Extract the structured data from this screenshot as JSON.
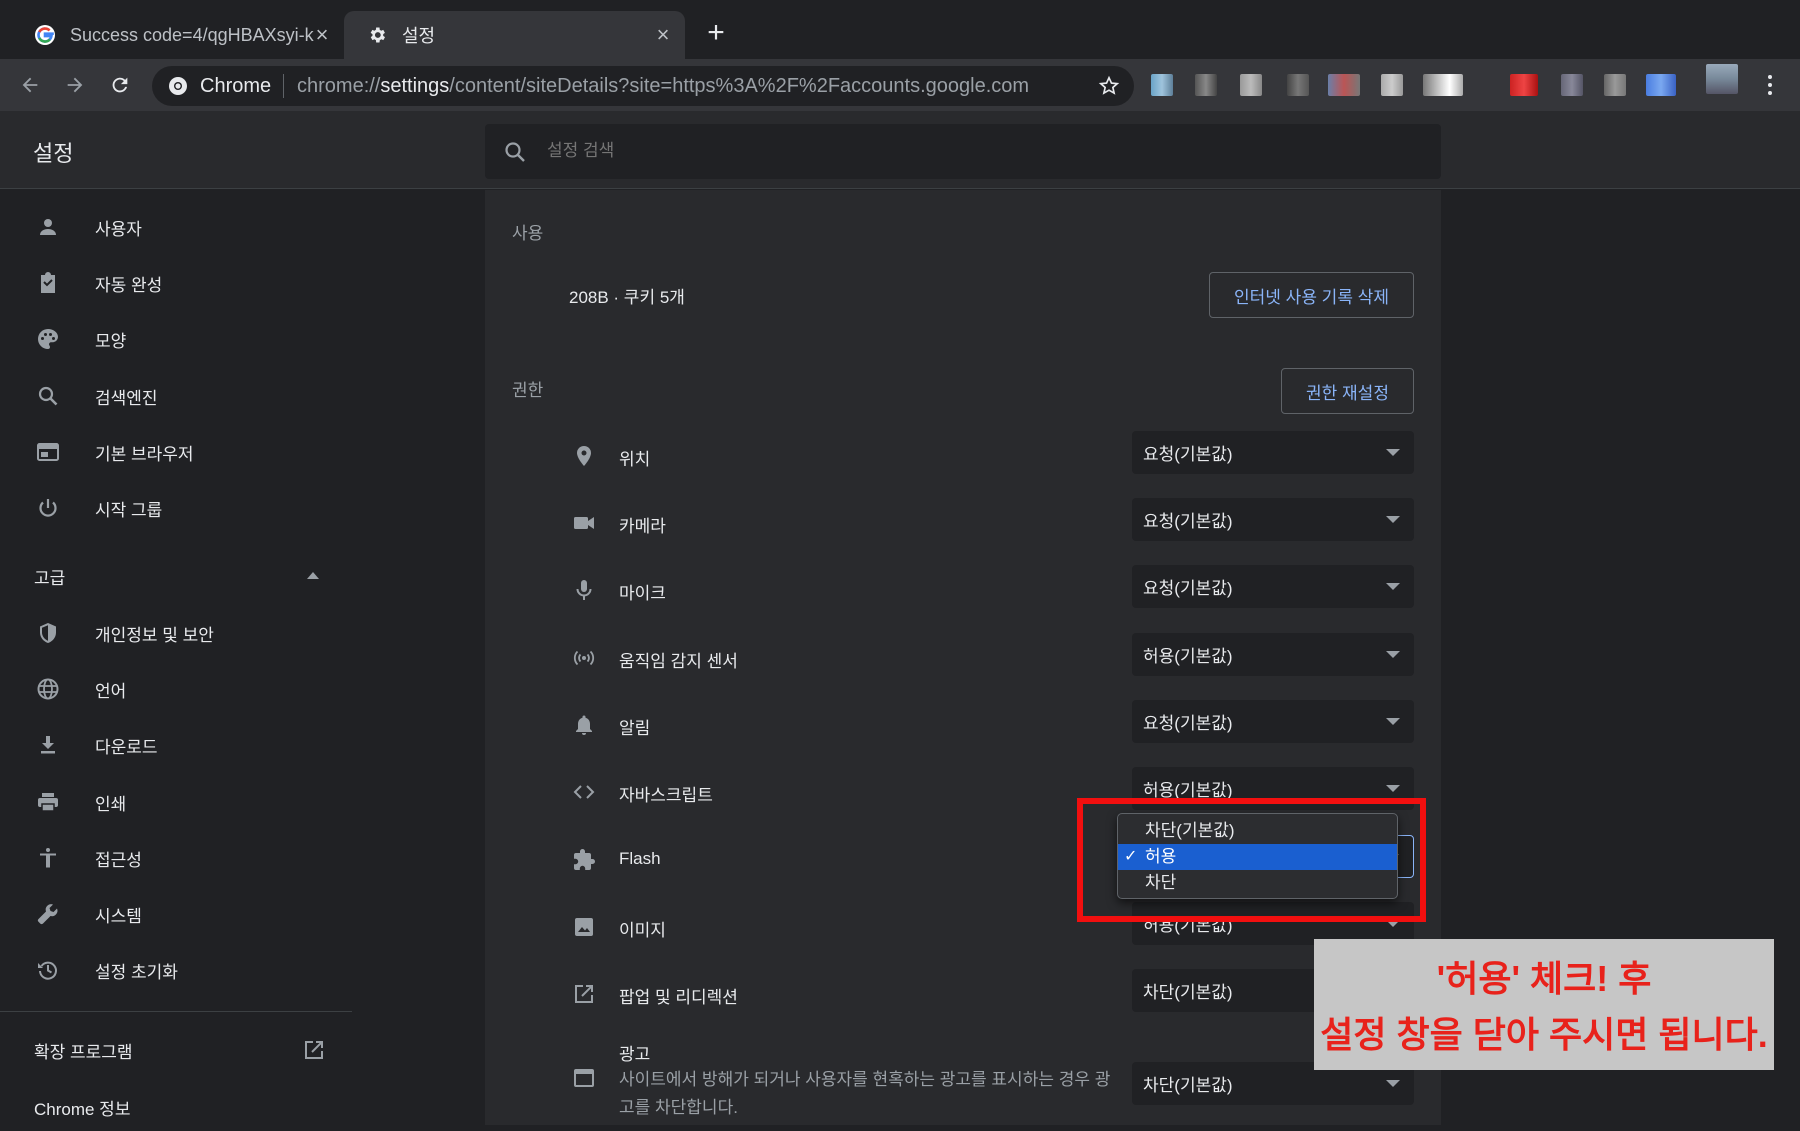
{
  "tabs": [
    {
      "title": "Success code=4/qgHBAXsyi-k",
      "icon": "google-g-icon",
      "active": false
    },
    {
      "title": "설정",
      "icon": "gear-icon",
      "active": true
    }
  ],
  "new_tab_label": "+",
  "omnibox": {
    "site_label": "Chrome",
    "url_prefix": "chrome://",
    "url_host": "settings",
    "url_path": "/content/siteDetails?site=https%3A%2F%2Faccounts.google.com"
  },
  "header": {
    "title": "설정",
    "search_placeholder": "설정 검색"
  },
  "sidebar": {
    "items": [
      {
        "label": "사용자",
        "icon": "person-icon"
      },
      {
        "label": "자동 완성",
        "icon": "clipboard-icon"
      },
      {
        "label": "모양",
        "icon": "palette-icon"
      },
      {
        "label": "검색엔진",
        "icon": "search-icon"
      },
      {
        "label": "기본 브라우저",
        "icon": "browser-icon"
      },
      {
        "label": "시작 그룹",
        "icon": "power-icon"
      }
    ],
    "advanced_label": "고급",
    "advanced_items": [
      {
        "label": "개인정보 및 보안",
        "icon": "shield-icon"
      },
      {
        "label": "언어",
        "icon": "globe-icon"
      },
      {
        "label": "다운로드",
        "icon": "download-icon"
      },
      {
        "label": "인쇄",
        "icon": "printer-icon"
      },
      {
        "label": "접근성",
        "icon": "accessibility-icon"
      },
      {
        "label": "시스템",
        "icon": "wrench-icon"
      },
      {
        "label": "설정 초기화",
        "icon": "history-icon"
      }
    ],
    "extensions_label": "확장 프로그램",
    "about_label": "Chrome 정보"
  },
  "usage": {
    "section_title": "사용",
    "summary": "208B · 쿠키 5개",
    "clear_button": "인터넷 사용 기록 삭제"
  },
  "permissions": {
    "section_title": "권한",
    "reset_button": "권한 재설정",
    "rows": [
      {
        "label": "위치",
        "icon": "location-pin-icon",
        "value": "요청(기본값)"
      },
      {
        "label": "카메라",
        "icon": "camera-icon",
        "value": "요청(기본값)"
      },
      {
        "label": "마이크",
        "icon": "microphone-icon",
        "value": "요청(기본값)"
      },
      {
        "label": "움직임 감지 센서",
        "icon": "sensor-icon",
        "value": "허용(기본값)"
      },
      {
        "label": "알림",
        "icon": "bell-icon",
        "value": "요청(기본값)"
      },
      {
        "label": "자바스크립트",
        "icon": "code-icon",
        "value": "허용(기본값)"
      },
      {
        "label": "Flash",
        "icon": "puzzle-icon",
        "value": ""
      },
      {
        "label": "이미지",
        "icon": "image-icon",
        "value": "허용(기본값)"
      },
      {
        "label": "팝업 및 리디렉션",
        "icon": "open-in-new-icon",
        "value": "차단(기본값)"
      },
      {
        "label": "광고",
        "icon": "ad-window-icon",
        "value": "차단(기본값)",
        "description": "사이트에서 방해가 되거나 사용자를 현혹하는 광고를 표시하는 경우 광고를 차단합니다."
      }
    ]
  },
  "flash_dropdown": {
    "options": [
      "차단(기본값)",
      "허용",
      "차단"
    ],
    "selected": "허용",
    "check_mark": "✓"
  },
  "annotation": {
    "line1": "'허용' 체크! 후",
    "line2": "설정 창을 닫아 주시면 됩니다."
  },
  "colors": {
    "accent": "#8ab4f8",
    "selected_option": "#1a5fd0",
    "annotation_red": "#f20f0f"
  }
}
